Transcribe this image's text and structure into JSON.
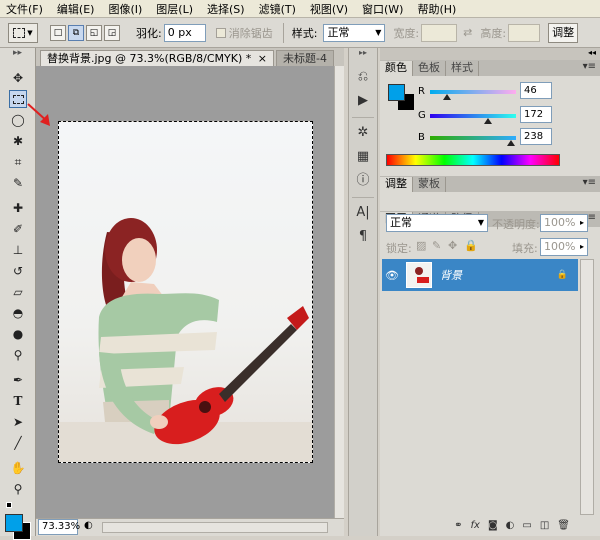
{
  "menu": [
    "文件(F)",
    "编辑(E)",
    "图像(I)",
    "图层(L)",
    "选择(S)",
    "滤镜(T)",
    "视图(V)",
    "窗口(W)",
    "帮助(H)"
  ],
  "options": {
    "feather_label": "羽化:",
    "feather_value": "0 px",
    "antialias_label": "消除锯齿",
    "style_label": "样式:",
    "style_value": "正常",
    "width_label": "宽度:",
    "height_label": "高度:",
    "adjust_button": "调整"
  },
  "document": {
    "tab_active": "替换背景.jpg @ 73.3%(RGB/8/CMYK) *",
    "tab_inactive": "未标题-4",
    "zoom": "73.33%"
  },
  "color_panel": {
    "tabs": [
      "颜色",
      "色板",
      "样式"
    ],
    "r_label": "R",
    "g_label": "G",
    "b_label": "B",
    "r": 46,
    "g": 172,
    "b": 238,
    "foreground": "#00a0e9",
    "background": "#000000"
  },
  "adjust_panel": {
    "tabs": [
      "调整",
      "蒙板"
    ]
  },
  "layers_panel": {
    "tabs": [
      "图层",
      "通道",
      "路径"
    ],
    "blend_mode": "正常",
    "opacity_label": "不透明度:",
    "opacity_value": "100%",
    "lock_label": "锁定:",
    "fill_label": "填充:",
    "fill_value": "100%",
    "layer_name": "背景"
  },
  "colors": {
    "selection_blue": "#3a86c6",
    "accent": "#00a0e9"
  }
}
